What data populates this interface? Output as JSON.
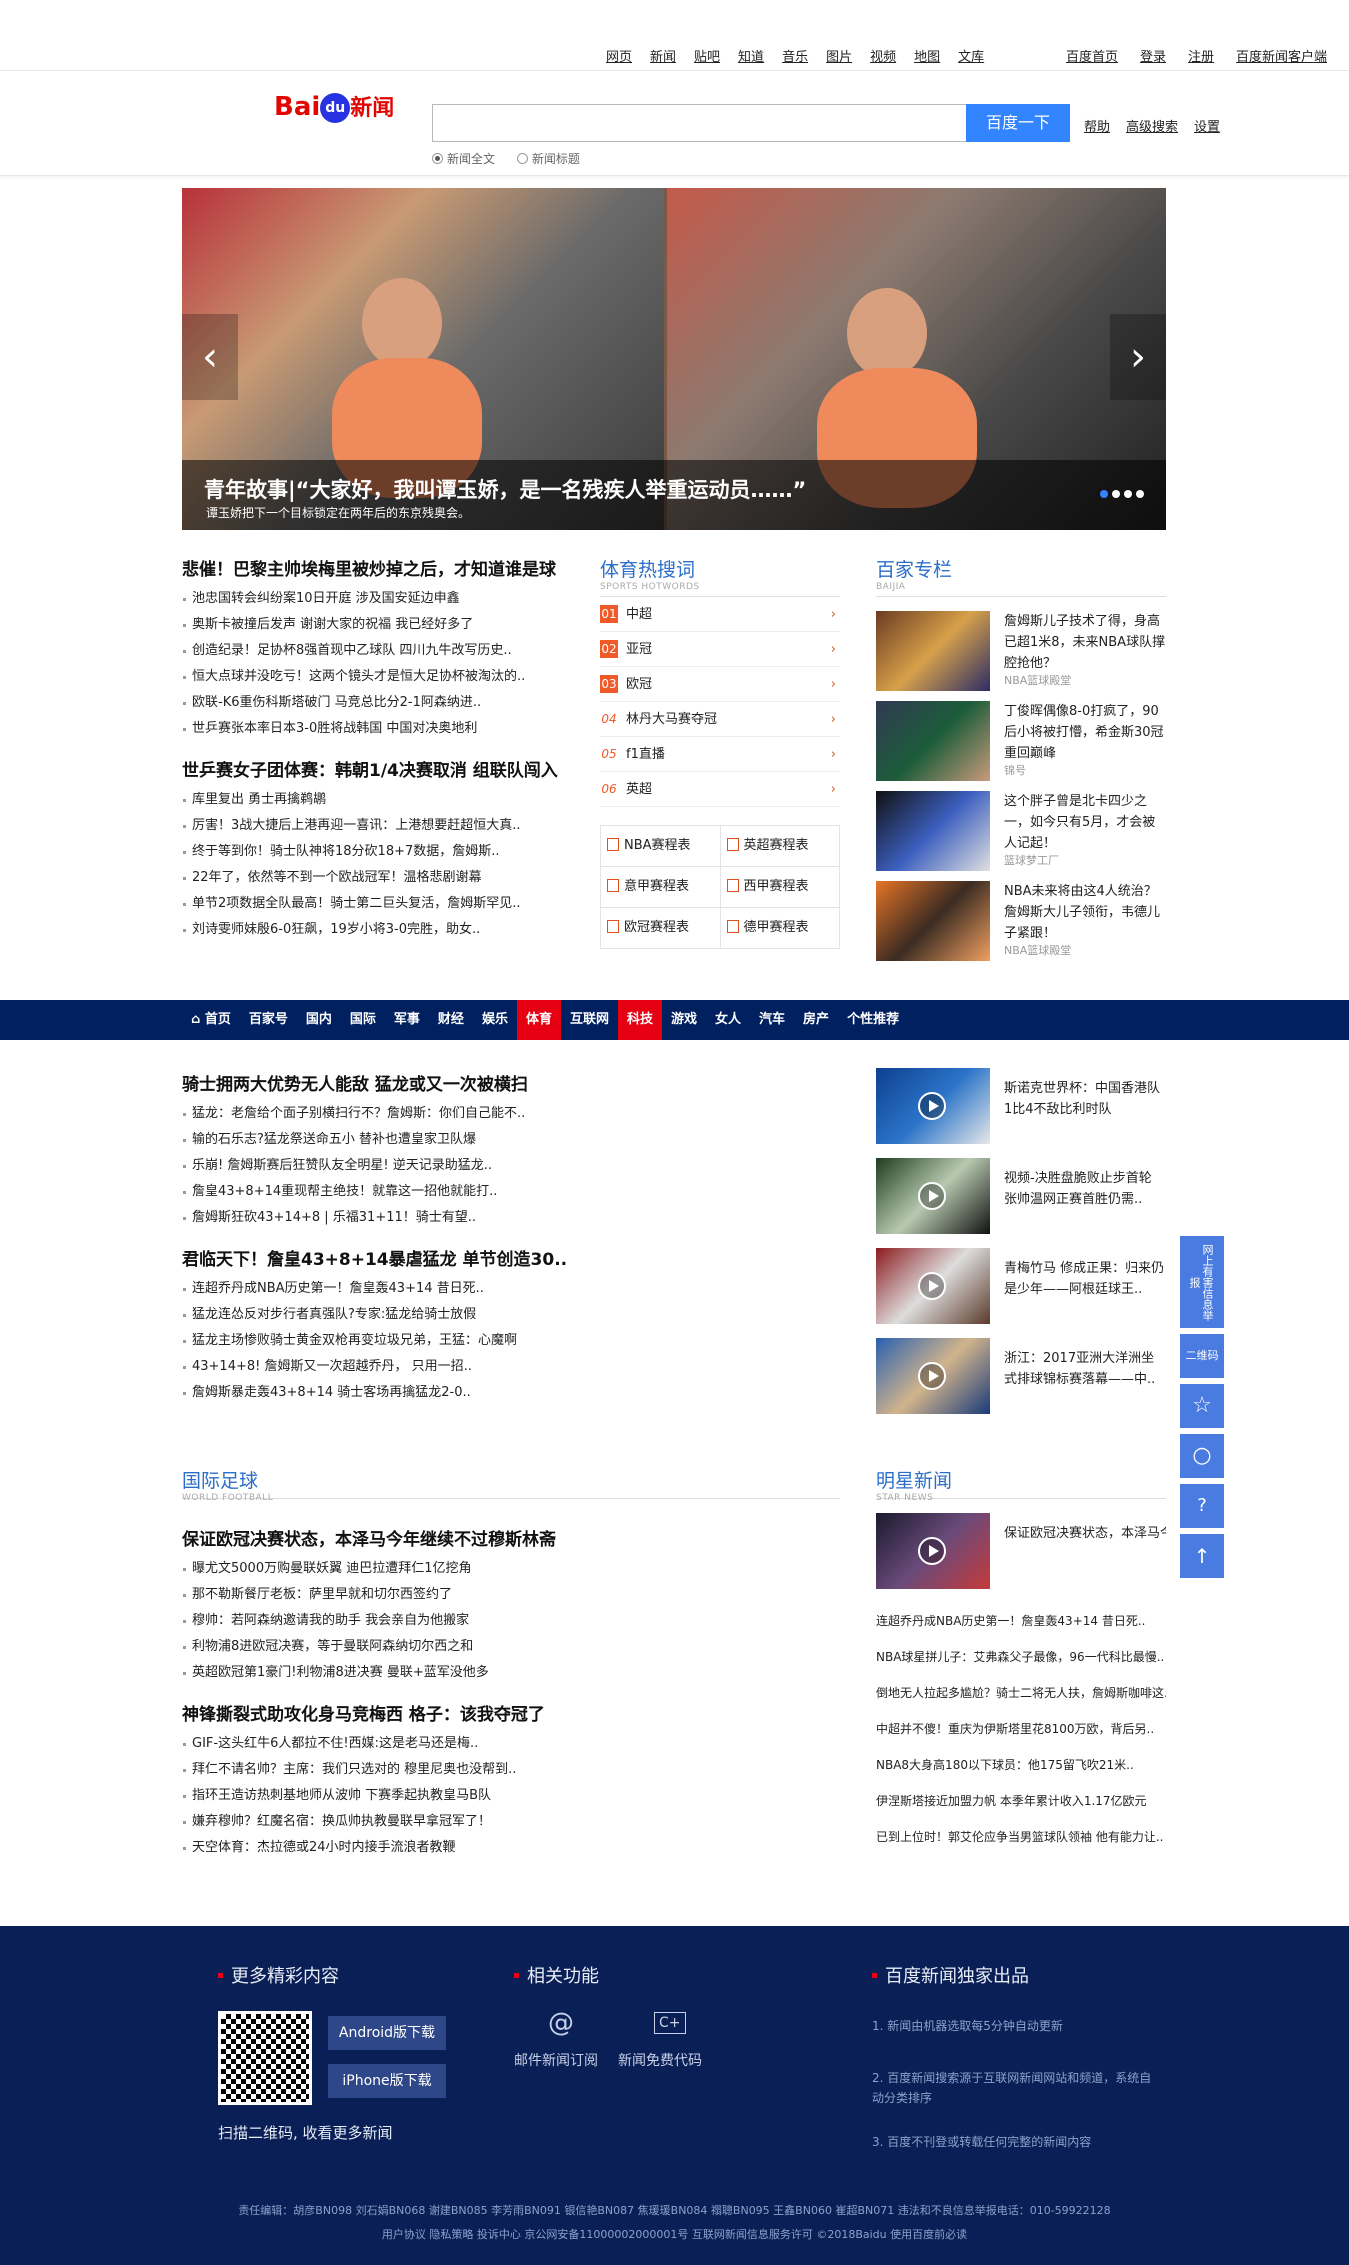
{
  "topnav": {
    "items": [
      "网页",
      "新闻",
      "贴吧",
      "知道",
      "音乐",
      "图片",
      "视频",
      "地图",
      "文库"
    ],
    "right": [
      "百度首页",
      "登录",
      "注册",
      "百度新闻客户端"
    ]
  },
  "header": {
    "logo_bai": "Bai",
    "logo_du": "du",
    "logo_news": "新闻",
    "search_placeholder": "",
    "search_button": "百度一下",
    "links": [
      "帮助",
      "高级搜索",
      "设置"
    ],
    "radio_all": "新闻全文",
    "radio_title": "新闻标题"
  },
  "slider": {
    "title": "青年故事|“大家好，我叫谭玉娇，是一名残疾人举重运动员……”",
    "subtitle": "谭玉娇把下一个目标锁定在两年后的东京残奥会。",
    "prev": "‹",
    "next": "›"
  },
  "hot_news": [
    {
      "headline": "悲催！巴黎主帅埃梅里被炒掉之后，才知道谁是球",
      "items": [
        "池忠国转会纠纷案10日开庭 涉及国安延边申鑫",
        "奥斯卡被撞后发声 谢谢大家的祝福 我已经好多了",
        "创造纪录！足协杯8强首现中乙球队 四川九牛改写历史..",
        "恒大点球并没吃亏！这两个镜头才是恒大足协杯被淘汰的..",
        "欧联-K6重伤科斯塔破门 马竞总比分2-1阿森纳进..",
        "世乒赛张本率日本3-0胜将战韩国 中国对决奥地利"
      ]
    },
    {
      "headline": "世乒赛女子团体赛：韩朝1/4决赛取消 组联队闯入",
      "items": [
        "库里复出 勇士再擒鹈鹕",
        "厉害！3战大捷后上港再迎一喜讯：上港想要赶超恒大真..",
        "终于等到你！骑士队神将18分砍18+7数据，詹姆斯..",
        "22年了，依然等不到一个欧战冠军！温格悲剧谢幕",
        "单节2项数据全队最高！骑士第二巨头复活，詹姆斯罕见..",
        "刘诗雯师妹殷6-0狂飙，19岁小将3-0完胜，助女.."
      ]
    }
  ],
  "hotwords": {
    "title": "体育热搜词",
    "sub": "SPORTS HOTWORDS",
    "items": [
      {
        "n": "01",
        "t": "中超"
      },
      {
        "n": "02",
        "t": "亚冠"
      },
      {
        "n": "03",
        "t": "欧冠"
      },
      {
        "n": "04",
        "t": "林丹大马赛夺冠"
      },
      {
        "n": "05",
        "t": "f1直播"
      },
      {
        "n": "06",
        "t": "英超"
      }
    ],
    "tables": [
      "NBA赛程表",
      "英超赛程表",
      "意甲赛程表",
      "西甲赛程表",
      "欧冠赛程表",
      "德甲赛程表"
    ]
  },
  "baijia": {
    "title": "百家专栏",
    "sub": "BAIJIA",
    "items": [
      {
        "t": "詹姆斯儿子技术了得，身高已超1米8，未来NBA球队撑腔抢他？",
        "src": "NBA篮球殿堂"
      },
      {
        "t": "丁俊晖偶像8-0打疯了，90后小将被打懵，希金斯30冠重回巅峰",
        "src": "锦号"
      },
      {
        "t": "这个胖子曾是北卡四少之一，如今只有5月，才会被人记起！",
        "src": "篮球梦工厂"
      },
      {
        "t": "NBA未来将由这4人统治？詹姆斯大儿子领衔，韦德儿子紧跟！",
        "src": "NBA篮球殿堂"
      }
    ]
  },
  "channels": [
    "首页",
    "百家号",
    "国内",
    "国际",
    "军事",
    "财经",
    "娱乐",
    "体育",
    "互联网",
    "科技",
    "游戏",
    "女人",
    "汽车",
    "房产",
    "个性推荐"
  ],
  "sports": [
    {
      "headline": "骑士拥两大优势无人能敌 猛龙或又一次被横扫",
      "items": [
        "猛龙：老詹给个面子别横扫行不？詹姆斯：你们自己能不..",
        "输的石乐志?猛龙祭送命五小 替补也遭皇家卫队爆",
        "乐崩! 詹姆斯赛后狂赞队友全明星! 逆天记录助猛龙..",
        "詹皇43+8+14重现帮主绝技！就靠这一招他就能打..",
        "詹姆斯狂砍43+14+8 | 乐福31+11！骑士有望.."
      ]
    },
    {
      "headline": "君临天下！詹皇43+8+14暴虐猛龙 单节创造30..",
      "items": [
        "连超乔丹成NBA历史第一！詹皇轰43+14 昔日死..",
        "猛龙连怂反对步行者真强队?专家:猛龙给骑士放假",
        "猛龙主场惨败骑士黄金双枪再变垃圾兄弟，王猛：心魔啊",
        "43+14+8! 詹姆斯又一次超越乔丹， 只用一招..",
        "詹姆斯暴走轰43+8+14 骑士客场再擒猛龙2-0.."
      ]
    }
  ],
  "videos": [
    {
      "t": "斯诺克世界杯：中国香港队1比4不敌比利时队"
    },
    {
      "t": "视频-决胜盘脆败止步首轮 张帅温网正赛首胜仍需.."
    },
    {
      "t": "青梅竹马 修成正果：归来仍是少年——阿根廷球王.."
    },
    {
      "t": "浙江：2017亚洲大洋洲坐式排球锦标赛落幕——中.."
    }
  ],
  "football": {
    "title": "国际足球",
    "sub": "WORLD FOOTBALL",
    "blocks": [
      {
        "headline": "保证欧冠决赛状态，本泽马今年继续不过穆斯林斋",
        "items": [
          "曝尤文5000万购曼联妖翼 迪巴拉遭拜仁1亿挖角",
          "那不勒斯餐厅老板：萨里早就和切尔西签约了",
          "穆帅：若阿森纳邀请我的助手 我会亲自为他搬家",
          "利物浦8进欧冠决赛，等于曼联阿森纳切尔西之和",
          "英超欧冠第1豪门!利物浦8进决赛 曼联+蓝军没他多"
        ]
      },
      {
        "headline": "神锋撕裂式助攻化身马竞梅西 格子：该我夺冠了",
        "items": [
          "GIF-这头红牛6人都拉不住!西媒:这是老马还是梅..",
          "拜仁不请名帅？主席：我们只选对的 穆里尼奥也没帮到..",
          "指环王造访热刺基地师从波帅 下赛季起执教皇马B队",
          "嫌弃穆帅？红魔名宿：换瓜帅执教曼联早拿冠军了！",
          "天空体育：杰拉德或24小时内接手流浪者教鞭"
        ]
      }
    ]
  },
  "star": {
    "title": "明星新闻",
    "sub": "STAR NEWS",
    "top": "保证欧冠决赛状态，本泽马今年继续不过穆斯林斋",
    "items": [
      "连超乔丹成NBA历史第一！詹皇轰43+14 昔日死..",
      "NBA球星拼儿子：艾弗森父子最像，96一代科比最慢..",
      "倒地无人拉起多尴尬？骑士二将无人扶，詹姆斯咖啡这..",
      "中超并不傻！重庆为伊斯塔里花8100万欧，背后另..",
      "NBA8大身高180以下球员：他175留飞吹21米..",
      "伊涅斯塔接近加盟力帆 本季年累计收入1.17亿欧元",
      "已到上位时！郭艾伦应争当男篮球队领袖 他有能力让.."
    ]
  },
  "side": {
    "report": "网上有害信息举报",
    "qr": "二维码",
    "star": "☆",
    "search": "○",
    "feedback": "?",
    "top": "↑"
  },
  "footer": {
    "more": "更多精彩内容",
    "android": "Android版下载",
    "iphone": "iPhone版下载",
    "scan": "扫描二维码, 收看更多新闻",
    "related": "相关功能",
    "mail": "邮件新闻订阅",
    "code": "新闻免费代码",
    "mail_icon": "@",
    "code_icon": "C+",
    "exclusive": "百度新闻独家出品",
    "notes": [
      "1. 新闻由机器选取每5分钟自动更新",
      "2. 百度新闻搜索源于互联网新闻网站和频道，系统自动分类排序",
      "3. 百度不刊登或转载任何完整的新闻内容"
    ],
    "editors": "责任编辑：胡彦BN098 刘石娟BN068 谢建BN085 李芳雨BN091 银信艳BN087 焦瑗瑗BN084 禤聰BN095 王鑫BN060 崔超BN071 违法和不良信息举报电话：010-59922128",
    "legal": "用户协议 隐私策略 投诉中心 京公网安备11000002000001号 互联网新闻信息服务许可 ©2018Baidu 使用百度前必读"
  }
}
